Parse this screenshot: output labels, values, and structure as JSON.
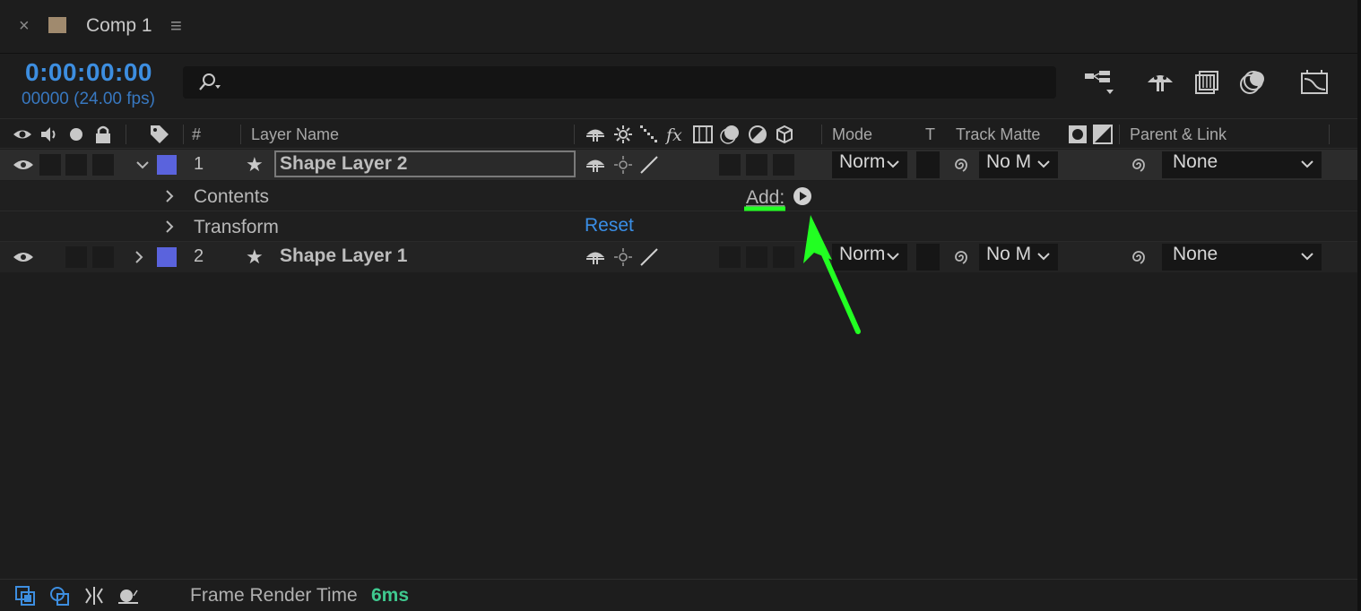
{
  "tab": {
    "close": "×",
    "title": "Comp 1",
    "menu": "≡"
  },
  "time": {
    "timecode": "0:00:00:00",
    "frames": "00000 (24.00 fps)"
  },
  "search": {
    "placeholder": ""
  },
  "columns": {
    "number": "#",
    "layer_name": "Layer Name",
    "mode": "Mode",
    "t": "T",
    "track_matte": "Track Matte",
    "parent_link": "Parent & Link"
  },
  "layers": [
    {
      "number": "1",
      "name": "Shape Layer 2",
      "mode": "Norm",
      "matte": "No M",
      "parent": "None",
      "label_color": "#5a63dd",
      "expanded": true,
      "selected": true
    },
    {
      "number": "2",
      "name": "Shape Layer 1",
      "mode": "Norm",
      "matte": "No M",
      "parent": "None",
      "label_color": "#5a63dd",
      "expanded": false,
      "selected": false
    }
  ],
  "properties": {
    "contents": "Contents",
    "add_label": "Add:",
    "transform": "Transform",
    "reset": "Reset"
  },
  "footer": {
    "frame_render_label": "Frame Render Time",
    "frame_render_value": "6ms"
  },
  "colors": {
    "accent": "#3d8ee0",
    "annotation": "#22ff22",
    "render_time": "#3fc98f"
  }
}
